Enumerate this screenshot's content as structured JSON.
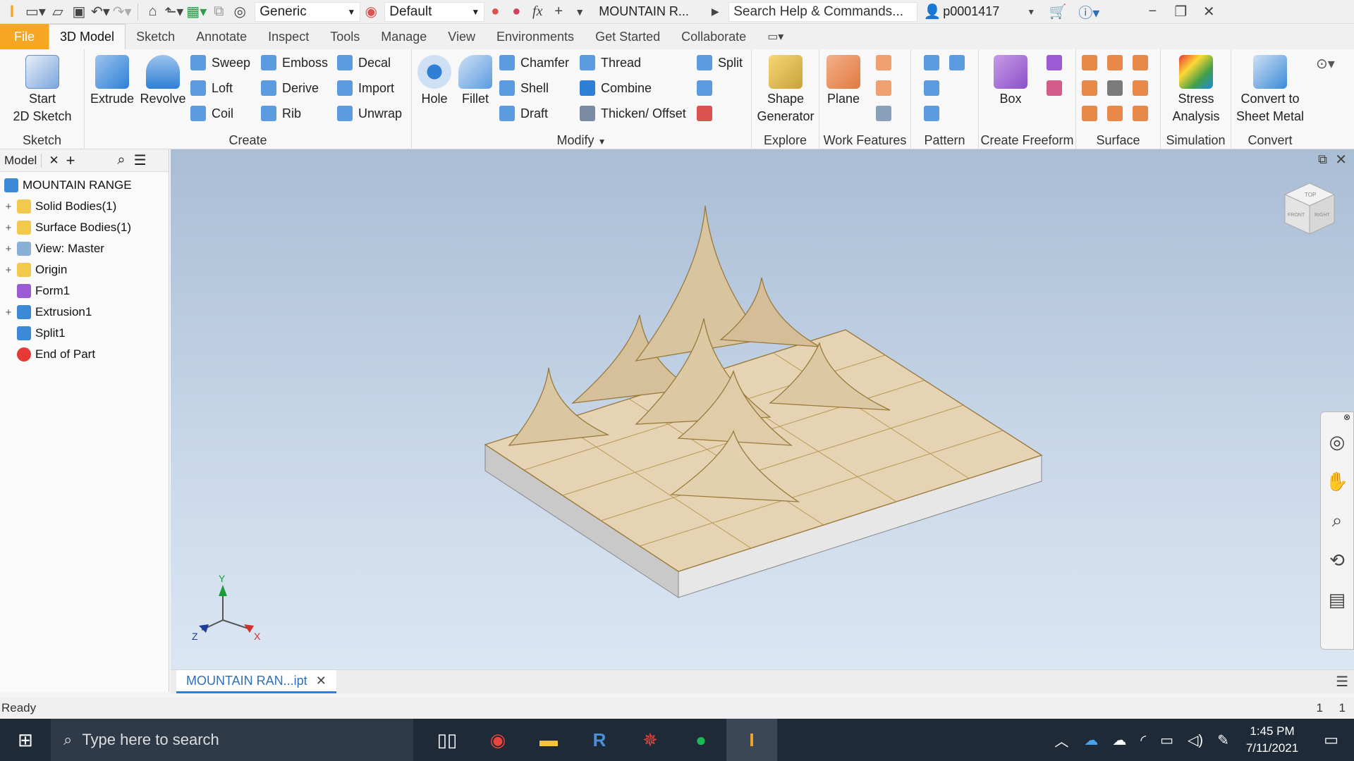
{
  "qat": {
    "appearance": "Generic",
    "material": "Default",
    "doc_title": "MOUNTAIN R...",
    "search_placeholder": "Search Help & Commands...",
    "user": "p0001417",
    "fx_label": "fx"
  },
  "tabs": [
    {
      "label": "File"
    },
    {
      "label": "3D Model"
    },
    {
      "label": "Sketch"
    },
    {
      "label": "Annotate"
    },
    {
      "label": "Inspect"
    },
    {
      "label": "Tools"
    },
    {
      "label": "Manage"
    },
    {
      "label": "View"
    },
    {
      "label": "Environments"
    },
    {
      "label": "Get Started"
    },
    {
      "label": "Collaborate"
    }
  ],
  "ribbon": {
    "sketch": {
      "title": "Sketch",
      "start": "Start",
      "start2": "2D Sketch"
    },
    "create": {
      "title": "Create",
      "extrude": "Extrude",
      "revolve": "Revolve",
      "sweep": "Sweep",
      "loft": "Loft",
      "coil": "Coil",
      "emboss": "Emboss",
      "derive": "Derive",
      "rib": "Rib",
      "decal": "Decal",
      "import": "Import",
      "unwrap": "Unwrap"
    },
    "modify": {
      "title": "Modify",
      "hole": "Hole",
      "fillet": "Fillet",
      "chamfer": "Chamfer",
      "shell": "Shell",
      "draft": "Draft",
      "thread": "Thread",
      "combine": "Combine",
      "thicken": "Thicken/ Offset",
      "split": "Split"
    },
    "explore": {
      "title": "Explore",
      "shape": "Shape",
      "shape2": "Generator"
    },
    "work": {
      "title": "Work Features",
      "plane": "Plane"
    },
    "pattern": {
      "title": "Pattern"
    },
    "freeform": {
      "title": "Create Freeform",
      "box": "Box"
    },
    "surface": {
      "title": "Surface"
    },
    "simulation": {
      "title": "Simulation",
      "stress": "Stress",
      "stress2": "Analysis"
    },
    "convert": {
      "title": "Convert",
      "conv": "Convert to",
      "conv2": "Sheet Metal"
    }
  },
  "browser": {
    "tab": "Model",
    "root": "MOUNTAIN RANGE",
    "nodes": [
      {
        "label": "Solid Bodies(1)"
      },
      {
        "label": "Surface Bodies(1)"
      },
      {
        "label": "View: Master"
      },
      {
        "label": "Origin"
      },
      {
        "label": "Form1"
      },
      {
        "label": "Extrusion1"
      },
      {
        "label": "Split1"
      },
      {
        "label": "End of Part"
      }
    ]
  },
  "viewcube": {
    "top": "TOP",
    "front": "FRONT",
    "right": "RIGHT"
  },
  "triad": {
    "x": "X",
    "y": "Y",
    "z": "Z"
  },
  "doc_tab": "MOUNTAIN RAN...ipt",
  "status": {
    "text": "Ready",
    "count1": "1",
    "count2": "1"
  },
  "taskbar": {
    "search": "Type here to search",
    "time": "1:45 PM",
    "date": "7/11/2021"
  },
  "colors": {
    "file_tab": "#f5a623",
    "accent": "#2f7fd6",
    "terrain": "#e6d3b3",
    "taskbar": "#1f2a38"
  }
}
